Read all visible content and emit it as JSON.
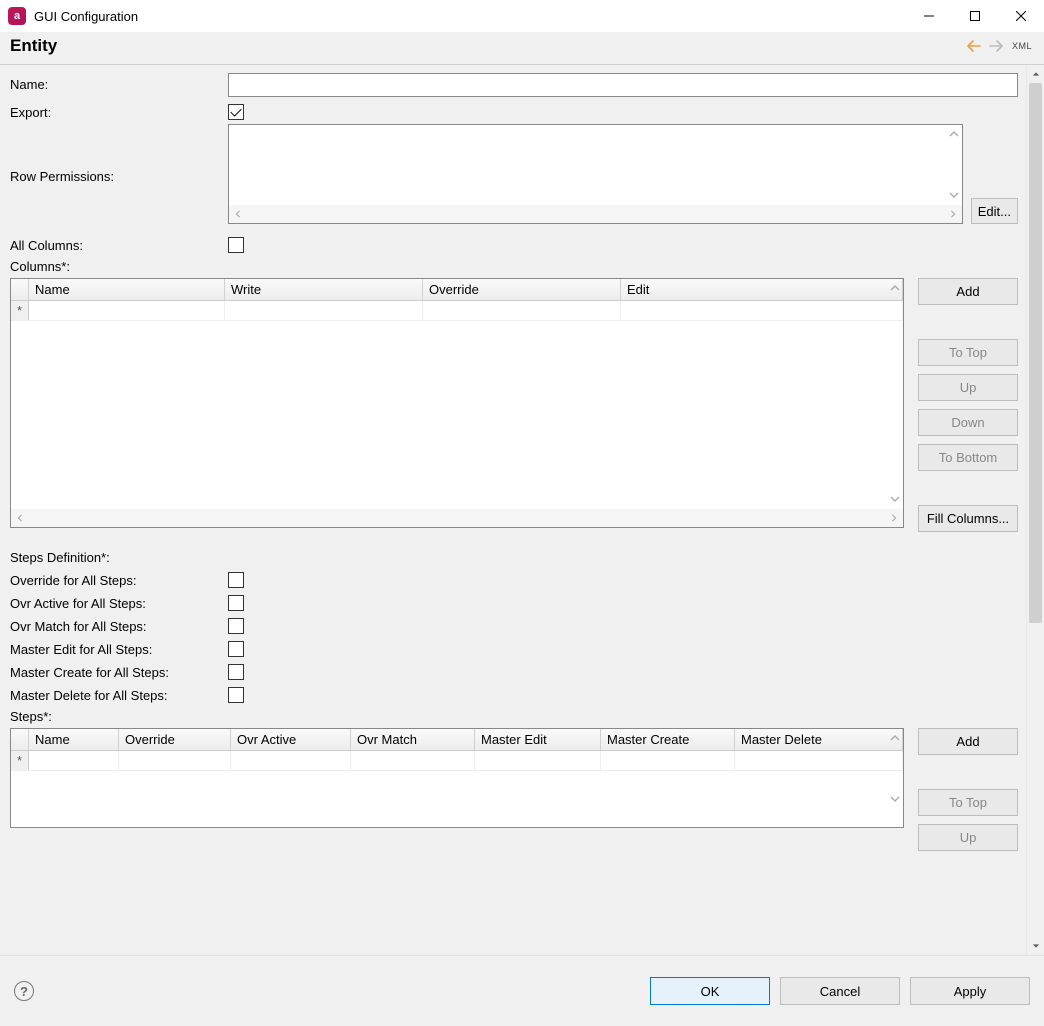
{
  "window": {
    "title": "GUI Configuration"
  },
  "header": {
    "title": "Entity",
    "xml_label": "XML"
  },
  "fields": {
    "name_label": "Name:",
    "name_value": "",
    "export_label": "Export:",
    "export_checked": true,
    "row_permissions_label": "Row Permissions:",
    "edit_button": "Edit...",
    "all_columns_label": "All Columns:",
    "all_columns_checked": false,
    "columns_label": "Columns*:",
    "steps_definition_label": "Steps Definition*:",
    "override_all_label": "Override for All Steps:",
    "override_all_checked": false,
    "ovr_active_all_label": "Ovr Active for All Steps:",
    "ovr_active_all_checked": false,
    "ovr_match_all_label": "Ovr Match for All Steps:",
    "ovr_match_all_checked": false,
    "master_edit_all_label": "Master Edit for All Steps:",
    "master_edit_all_checked": false,
    "master_create_all_label": "Master Create for All Steps:",
    "master_create_all_checked": false,
    "master_delete_all_label": "Master Delete for All Steps:",
    "master_delete_all_checked": false,
    "steps_label": "Steps*:"
  },
  "columns_grid": {
    "headers": {
      "name": "Name",
      "write": "Write",
      "override": "Override",
      "edit": "Edit"
    },
    "new_row_marker": "*",
    "rows": []
  },
  "steps_grid": {
    "headers": {
      "name": "Name",
      "override": "Override",
      "ovr_active": "Ovr Active",
      "ovr_match": "Ovr Match",
      "master_edit": "Master Edit",
      "master_create": "Master Create",
      "master_delete": "Master Delete"
    },
    "new_row_marker": "*",
    "rows": []
  },
  "grid_buttons": {
    "add": "Add",
    "to_top": "To Top",
    "up": "Up",
    "down": "Down",
    "to_bottom": "To Bottom",
    "fill_columns": "Fill Columns..."
  },
  "footer": {
    "ok": "OK",
    "cancel": "Cancel",
    "apply": "Apply"
  }
}
